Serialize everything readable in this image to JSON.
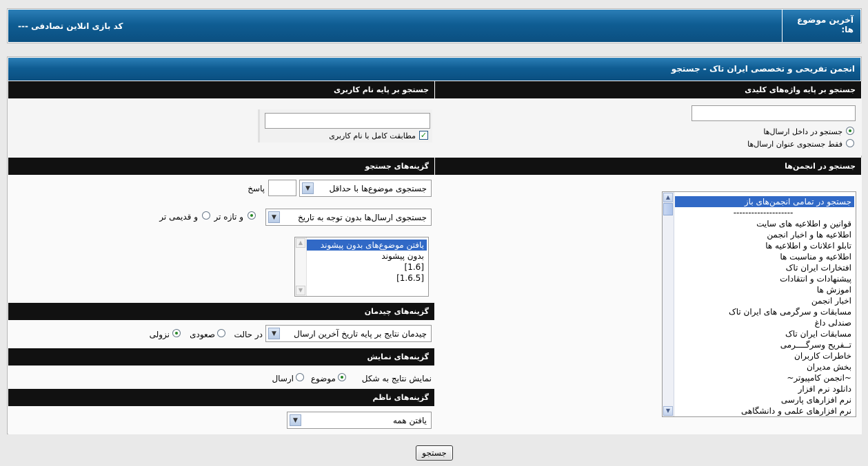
{
  "topbar": {
    "latest_topics_label": "آخرین موضوع ها:",
    "random_link": "--- کد بازی انلاین تصادفی"
  },
  "main": {
    "title": "انجمن تفریحی و تخصصی ایران تاک - جستجو"
  },
  "keyword_search": {
    "header": "جستجو بر پایه واژه‌های کلیدی",
    "input_value": "",
    "option_in_posts": "جستجو در داخل ارسال‌ها",
    "option_titles_only": "فقط جستجوی عنوان ارسال‌ها",
    "selected": "in_posts"
  },
  "username_search": {
    "header": "جستجو بر پایه نام کاربری",
    "input_value": "",
    "exact_match_label": "مطابقت کامل با نام کاربری",
    "exact_match_checked": true
  },
  "forums_search": {
    "header": "جستجو در انجمن‌ها",
    "items": [
      "جستجو در تمامی انجمن‌های باز",
      "--------------------",
      "قوانین و اطلاعیه های سایت",
      "اطلاعیه ها و اخبار انجمن",
      "تابلو اعلانات و اطلاعیه ها",
      "اطلاعیه و مناسبت ها",
      "افتخارات ایران تاک",
      "پیشنهادات و انتقادات",
      "اموزش ها",
      "اخبار انجمن",
      "مسابقات و سرگرمی های ایران تاک",
      "صندلی داغ",
      "مسابقات ایران تاک",
      "تــفریح وسرگــــرمی",
      "خاطرات کاربران",
      "بخش مدیران",
      "~انجمن کامپیوتر~",
      "دانلود نرم افزار",
      "نرم افزارهای پارسی",
      "نرم افزارهای علمی و دانشگاهی"
    ],
    "selected_index": 0
  },
  "search_options": {
    "header": "گزینه‌های جستجو",
    "min_replies_select": "جستجوی موضوع‌ها با حداقل",
    "min_replies_value": "",
    "replies_label": "پاسخ",
    "date_select": "جستجوی ارسال‌ها بدون توجه به تاریخ",
    "newer_label": "و تازه تر",
    "older_label": "و قدیمی تر",
    "date_direction": "newer",
    "prefix_items": [
      "یافتن موضوع‌های بدون پیشوند",
      "بدون پیشوند",
      "[1.6]",
      "[1.6.5]"
    ],
    "prefix_selected": 0
  },
  "sort_options": {
    "header": "گزینه‌های چیدمان",
    "sort_select": "چیدمان نتایج بر پایه تاریخ آخرین ارسال",
    "in_state_label": "در حالت",
    "ascending_label": "صعودی",
    "descending_label": "نزولی",
    "selected": "descending"
  },
  "display_options": {
    "header": "گزینه‌های نمایش",
    "show_as_label": "نمایش نتایج به شکل",
    "topics_label": "موضوع",
    "posts_label": "ارسال",
    "selected": "topics"
  },
  "moderator_options": {
    "header": "گزینه‌های ناظم",
    "select_value": "یافتن همه"
  },
  "submit_label": "جستجو"
}
